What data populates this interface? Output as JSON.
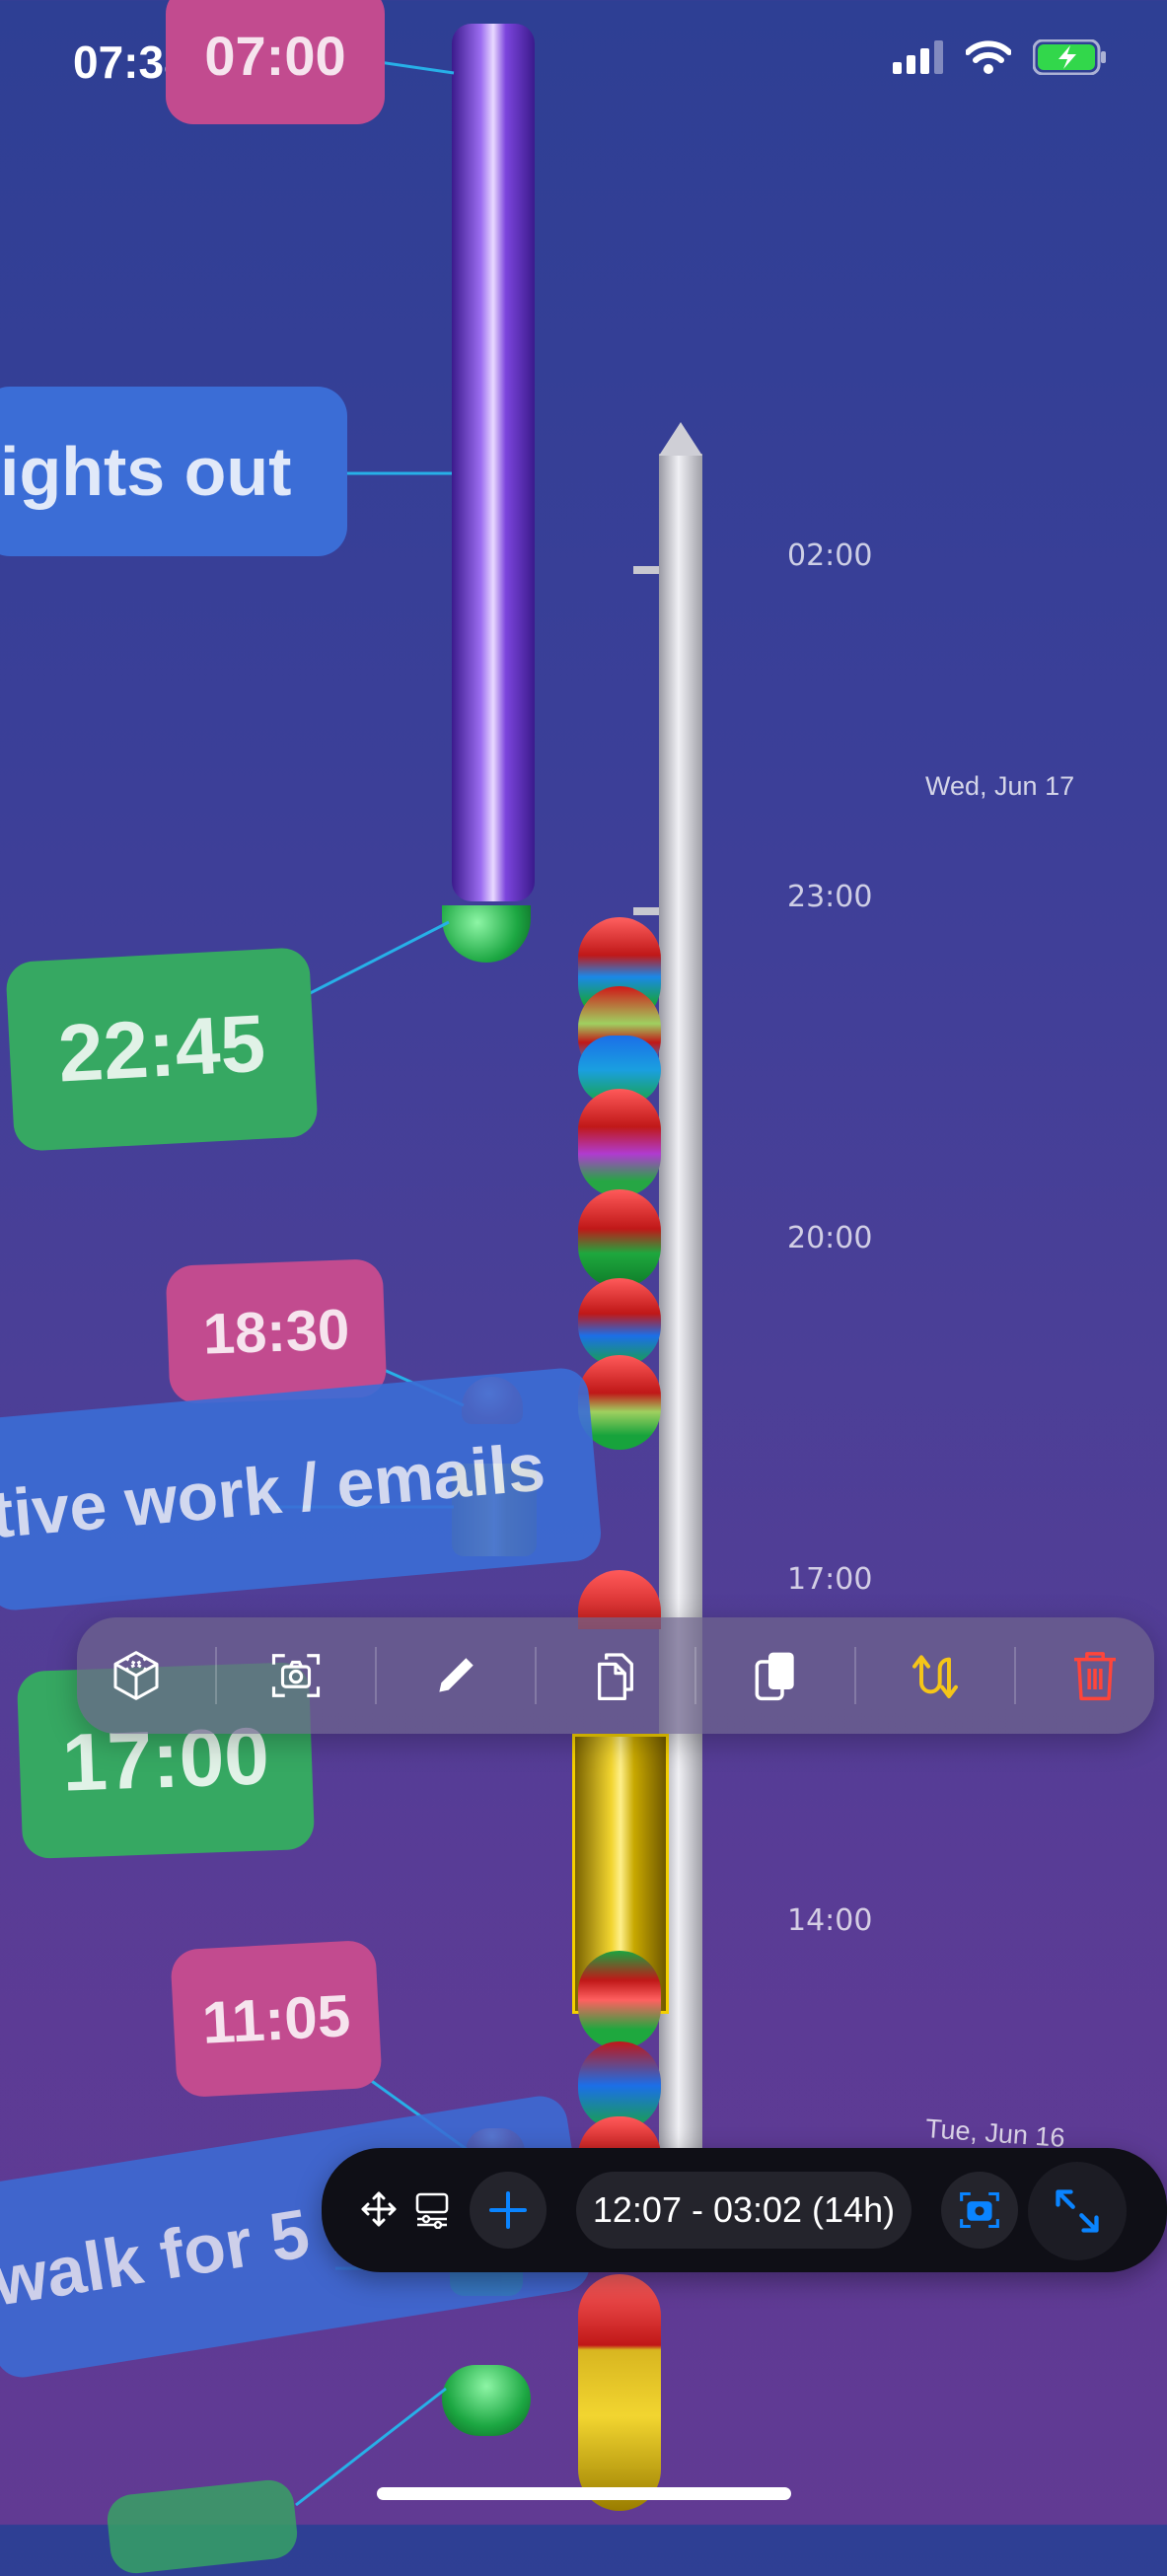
{
  "status_bar": {
    "time": "07:38"
  },
  "labels": {
    "pink_top": "07:00",
    "lights_out": "ights out",
    "green_2245": "22:45",
    "pink_1830": "18:30",
    "creative_work": "tive work / emails",
    "green_1700": "17:00",
    "pink_1105": "11:05",
    "walk": "walk for 5 m"
  },
  "axis": {
    "times": [
      "02:00",
      "23:00",
      "20:00",
      "17:00",
      "14:00"
    ],
    "dates": [
      "Wed, Jun 17",
      "Tue, Jun 16"
    ]
  },
  "bottom_bar": {
    "range": "12:07 - 03:02 (14h)"
  },
  "colors": {
    "accent": "#0a84ff",
    "swap": "#f5c518",
    "delete": "#ff453a"
  },
  "icons": {
    "toolbar": [
      "cube-icon",
      "camera-icon",
      "pencil-icon",
      "copy-icon",
      "duplicate-icon",
      "swap-icon",
      "trash-icon"
    ],
    "bottom": [
      "move-icon",
      "display-icon",
      "plus-icon",
      "screenshot-icon",
      "expand-icon"
    ]
  }
}
